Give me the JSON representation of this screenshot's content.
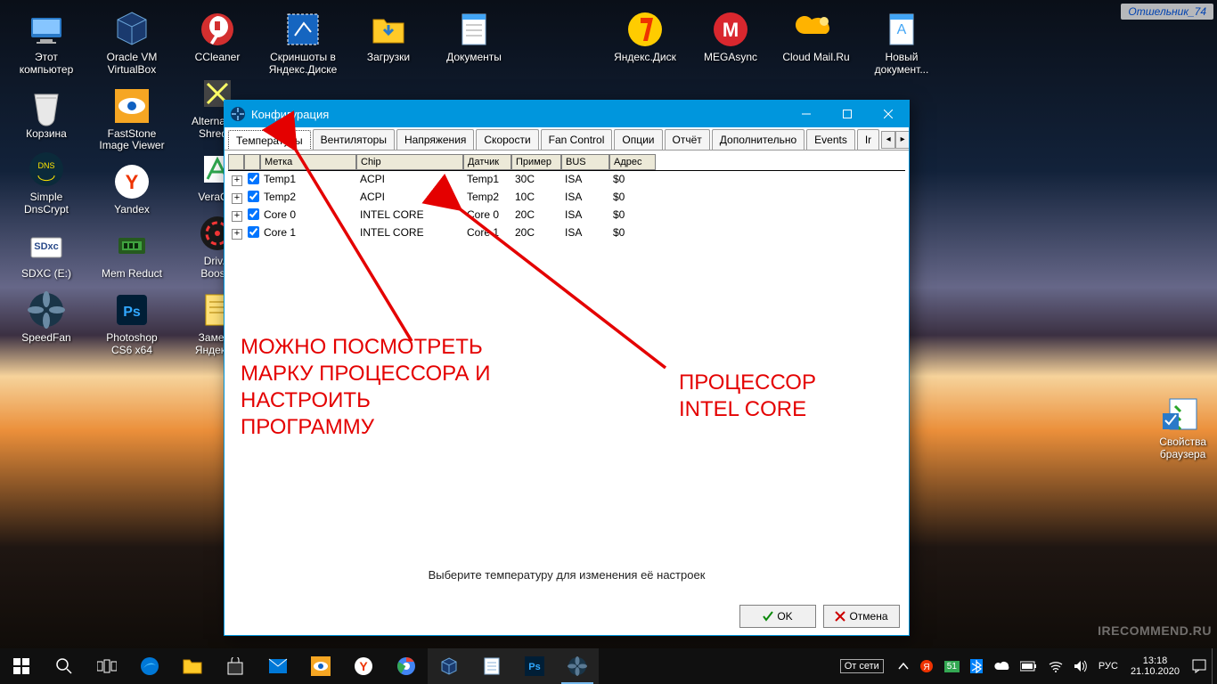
{
  "corner_badge": "Отшельник_74",
  "watermark": "IRECOMMEND.RU",
  "desktop": {
    "rows": [
      [
        "Этот\nкомпьютер",
        "Oracle VM\nVirtualBox",
        "CCleaner",
        "Скриншоты в\nЯндекс.Диске",
        "Загрузки",
        "Документы",
        "",
        "Яндекс.Диск",
        "MEGAsync",
        "Cloud Mail.Ru",
        "Новый\nдокумент..."
      ],
      [
        "Корзина",
        "FastStone\nImage Viewer",
        "Alternate...\nShred...",
        "",
        "",
        "",
        "",
        "",
        "",
        "",
        ""
      ],
      [
        "Simple\nDnsCrypt",
        "Yandex",
        "VeraС...",
        "",
        "",
        "",
        "",
        "",
        "",
        "",
        ""
      ],
      [
        "SDXC (E:)",
        "Mem Reduct",
        "Driv...\nBoos...",
        "",
        "",
        "",
        "",
        "",
        "",
        "",
        ""
      ],
      [
        "SpeedFan",
        "Photoshop\nCS6 x64",
        "Замет...\nЯндекс...",
        "",
        "",
        "",
        "",
        "",
        "",
        "",
        ""
      ]
    ],
    "right_icon": "Свойства\nбраузера"
  },
  "window": {
    "title": "Конфигурация",
    "tabs": [
      "Температуры",
      "Вентиляторы",
      "Напряжения",
      "Скорости",
      "Fan Control",
      "Опции",
      "Отчёт",
      "Дополнительно",
      "Events",
      "Ir"
    ],
    "active_tab": 0,
    "headers": {
      "label": "Метка",
      "chip": "Chip",
      "sensor": "Датчик",
      "sample": "Пример",
      "bus": "BUS",
      "addr": "Адрес"
    },
    "rows": [
      {
        "label": "Temp1",
        "chip": "ACPI",
        "sensor": "Temp1",
        "sample": "30C",
        "bus": "ISA",
        "addr": "$0",
        "checked": true
      },
      {
        "label": "Temp2",
        "chip": "ACPI",
        "sensor": "Temp2",
        "sample": "10C",
        "bus": "ISA",
        "addr": "$0",
        "checked": true
      },
      {
        "label": "Core 0",
        "chip": "INTEL CORE",
        "sensor": "Core 0",
        "sample": "20C",
        "bus": "ISA",
        "addr": "$0",
        "checked": true
      },
      {
        "label": "Core 1",
        "chip": "INTEL CORE",
        "sensor": "Core 1",
        "sample": "20C",
        "bus": "ISA",
        "addr": "$0",
        "checked": true
      }
    ],
    "hint": "Выберите температуру для изменения её настроек",
    "ok": "OK",
    "cancel": "Отмена"
  },
  "annotations": {
    "left": "МОЖНО ПОСМОТРЕТЬ\nМАРКУ ПРОЦЕССОРА И\nНАСТРОИТЬ\nПРОГРАММУ",
    "right": "ПРОЦЕССОР\nINTEL CORE"
  },
  "taskbar": {
    "net_label": "От сети",
    "lang": "РУС",
    "time": "13:18",
    "date": "21.10.2020",
    "tray_badge": "51"
  }
}
